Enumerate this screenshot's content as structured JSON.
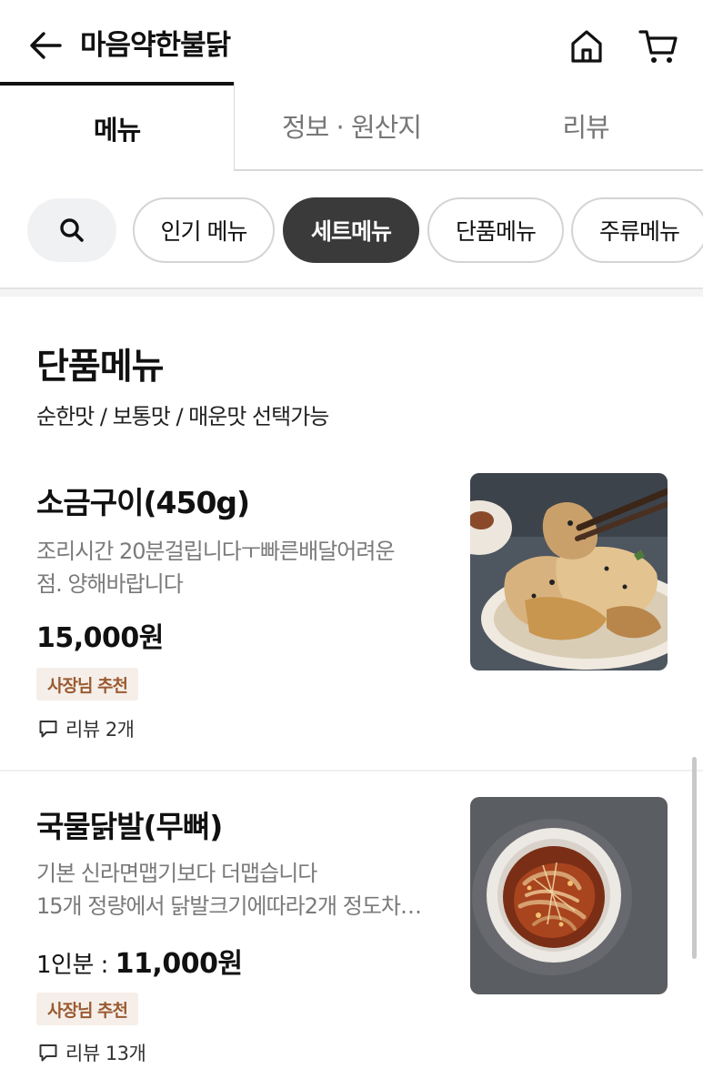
{
  "header": {
    "title": "마음약한불닭",
    "back_icon": "arrow-left-icon",
    "home_icon": "home-icon",
    "cart_icon": "cart-icon"
  },
  "tabs": [
    {
      "label": "메뉴",
      "active": true
    },
    {
      "label": "정보 · 원산지",
      "active": false
    },
    {
      "label": "리뷰",
      "active": false
    }
  ],
  "categories": {
    "search_icon": "search-icon",
    "chips": [
      {
        "label": "인기 메뉴",
        "selected": false
      },
      {
        "label": "세트메뉴",
        "selected": true
      },
      {
        "label": "단품메뉴",
        "selected": false
      },
      {
        "label": "주류메뉴",
        "selected": false
      }
    ]
  },
  "section": {
    "title": "단품메뉴",
    "description": "순한맛 / 보통맛 / 매운맛 선택가능"
  },
  "items": [
    {
      "name": "소금구이(450g)",
      "description_lines": [
        "조리시간  20분걸립니다ㅜ빠른배달어려운",
        "점. 양해바랍니다"
      ],
      "price_prefix": "",
      "price": "15,000원",
      "badge": "사장님 추천",
      "reviews": "리뷰 2개"
    },
    {
      "name": "국물닭발(무뼈)",
      "description_lines": [
        "기본 신라면맵기보다 더맵습니다",
        "15개 정량에서 닭발크기에따라2개 정도차…"
      ],
      "price_prefix": "1인분 : ",
      "price": "11,000원",
      "badge": "사장님 추천",
      "reviews": "리뷰 13개"
    }
  ],
  "colors": {
    "accent_dark": "#3a3a3a",
    "badge_bg": "#f6efe9",
    "badge_text": "#9a5b32"
  }
}
